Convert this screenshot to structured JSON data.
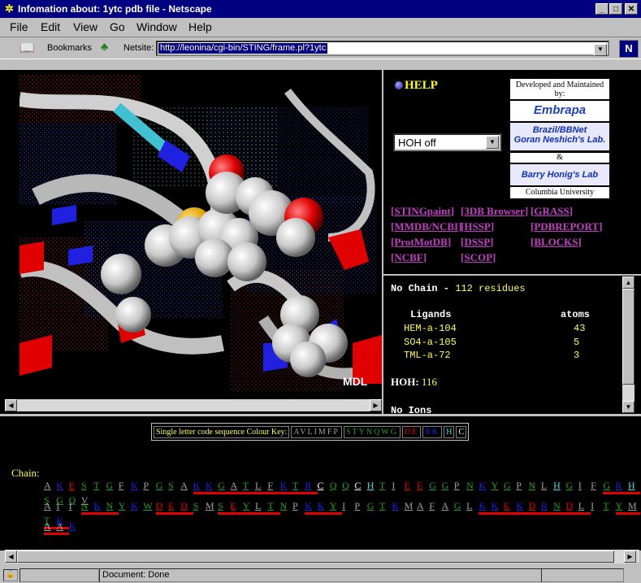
{
  "window": {
    "title": "Infomation about: 1ytc pdb file - Netscape"
  },
  "menu": [
    "File",
    "Edit",
    "View",
    "Go",
    "Window",
    "Help"
  ],
  "toolbar": {
    "bookmarks_label": "Bookmarks",
    "netsite_label": "Netsite:",
    "url": "http://leonina/cgi-bin/STING/frame.pl?1ytc"
  },
  "viewer": {
    "watermark": "MDL"
  },
  "help_link": "HELP",
  "hoh_select": {
    "value": "HOH off"
  },
  "credits": {
    "developed_by": "Developed and Maintained by:",
    "embrapa": "Embrapa",
    "brazil_line1": "Brazil/BBNet",
    "brazil_line2": "Goran Neshich's Lab.",
    "amp": "&",
    "honig": "Barry Honig's Lab",
    "columbia": "Columbia University"
  },
  "tool_links": [
    "STINGpaint",
    "3DB Browser",
    "GRASS",
    "MMDB/NCBI",
    "HSSP",
    "PDBREPORT",
    "ProtMotDB",
    "DSSP",
    "BLOCKS",
    "NCBF",
    "SCOP"
  ],
  "info_panel": {
    "chain_prefix": "No Chain",
    "chain_dash": " - ",
    "residues": "112 residues",
    "ligands_header": "Ligands",
    "atoms_header": "atoms",
    "ligands": [
      {
        "name": "HEM-a-104",
        "atoms": "43"
      },
      {
        "name": "SO4-a-105",
        "atoms": "5"
      },
      {
        "name": "TML-a-72",
        "atoms": "3"
      }
    ],
    "hoh_label": "HOH:",
    "hoh_value": "116",
    "ions": "No Ions"
  },
  "colour_key": {
    "label": "Single letter code sequence Colour Key:",
    "groups": [
      "AVLIMFP",
      "STYNQWG",
      "DE",
      "RK",
      "H",
      "C"
    ],
    "group_colors": [
      "#a0a0a0",
      "#20a020",
      "#e00000",
      "#2020e0",
      "#40e0e0",
      "#ffffff"
    ]
  },
  "chain_label": "Chain:",
  "sequence_rows": [
    "AKESTGFKPGSAKKGATLFKTRCQQCHTIEEGGPNKYGPNLHGIFGRHSGQV",
    "AIINKNYKWDEDSMSEYLTNPKKYIPGTKMAFAGLKKEKDRNDLITYMTK",
    "AAK"
  ],
  "status": {
    "text": "Document: Done"
  }
}
